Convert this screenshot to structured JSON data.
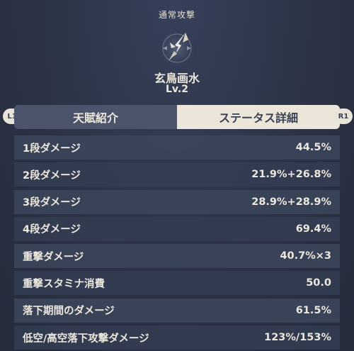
{
  "talent": {
    "type": "通常攻撃",
    "name": "玄鳥画水",
    "level": "Lv.2",
    "icon": "spear-star-icon"
  },
  "tabs": {
    "left_hint": "L1",
    "right_hint": "R1",
    "items": [
      {
        "label": "天賦紹介",
        "active": false
      },
      {
        "label": "ステータス詳細",
        "active": true
      }
    ]
  },
  "stats": [
    {
      "label": "1段ダメージ",
      "value": "44.5%"
    },
    {
      "label": "2段ダメージ",
      "value": "21.9%+26.8%"
    },
    {
      "label": "3段ダメージ",
      "value": "28.9%+28.9%"
    },
    {
      "label": "4段ダメージ",
      "value": "69.4%"
    },
    {
      "label": "重撃ダメージ",
      "value": "40.7%×3"
    },
    {
      "label": "重撃スタミナ消費",
      "value": "50.0"
    },
    {
      "label": "落下期間のダメージ",
      "value": "61.5%"
    },
    {
      "label": "低空/高空落下攻撃ダメージ",
      "value": "123%/153%"
    }
  ],
  "colors": {
    "background": "#2b3345",
    "tab_active": "#ece6da",
    "tab_inactive": "#4b546b",
    "text": "#ece7dc"
  }
}
